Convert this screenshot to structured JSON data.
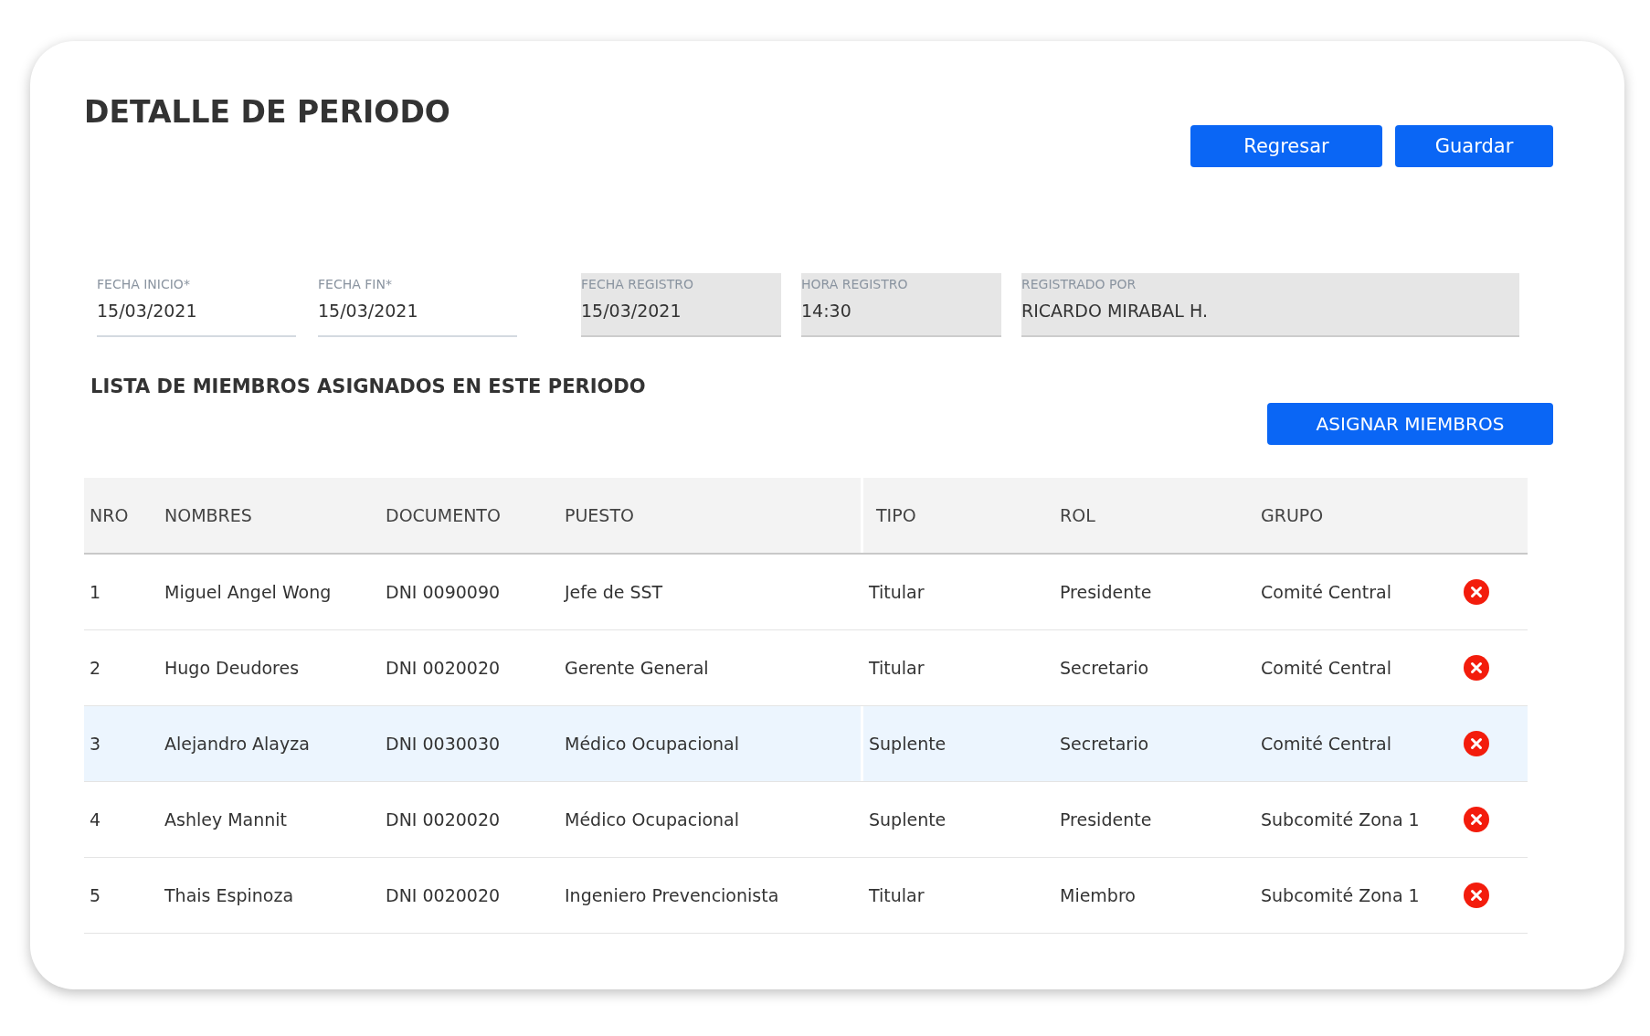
{
  "title": "DETALLE DE PERIODO",
  "actions": [
    "Regresar",
    "Guardar"
  ],
  "fields": [
    {
      "label": "FECHA INICIO*",
      "value": "15/03/2021",
      "kind": "editable"
    },
    {
      "label": "FECHA FIN*",
      "value": "15/03/2021",
      "kind": "editable"
    },
    {
      "label": "FECHA REGISTRO",
      "value": "15/03/2021",
      "kind": "readonly"
    },
    {
      "label": "HORA REGISTRO",
      "value": "14:30",
      "kind": "readonly"
    },
    {
      "label": "REGISTRADO POR",
      "value": "RICARDO MIRABAL H.",
      "kind": "readonly"
    }
  ],
  "members_heading": "LISTA DE MIEMBROS ASIGNADOS EN ESTE PERIODO",
  "assign_button": "ASIGNAR MIEMBROS",
  "table": {
    "columns": [
      "NRO",
      "NOMBRES",
      "DOCUMENTO",
      "PUESTO",
      "TIPO",
      "ROL",
      "GRUPO"
    ],
    "rows": [
      {
        "cells": [
          "1",
          "Miguel Angel Wong",
          "DNI 0090090",
          "Jefe de SST",
          "Titular",
          "Presidente",
          "Comité Central"
        ],
        "selected": false
      },
      {
        "cells": [
          "2",
          "Hugo Deudores",
          "DNI 0020020",
          "Gerente General",
          "Titular",
          "Secretario",
          "Comité Central"
        ],
        "selected": false
      },
      {
        "cells": [
          "3",
          "Alejandro Alayza",
          "DNI 0030030",
          "Médico Ocupacional",
          "Suplente",
          "Secretario",
          "Comité Central"
        ],
        "selected": true
      },
      {
        "cells": [
          "4",
          "Ashley Mannit",
          "DNI 0020020",
          "Médico Ocupacional",
          "Suplente",
          "Presidente",
          "Subcomité Zona 1"
        ],
        "selected": false
      },
      {
        "cells": [
          "5",
          "Thais Espinoza",
          "DNI 0020020",
          "Ingeniero Prevencionista",
          "Titular",
          "Miembro",
          "Subcomité Zona 1"
        ],
        "selected": false
      }
    ]
  }
}
